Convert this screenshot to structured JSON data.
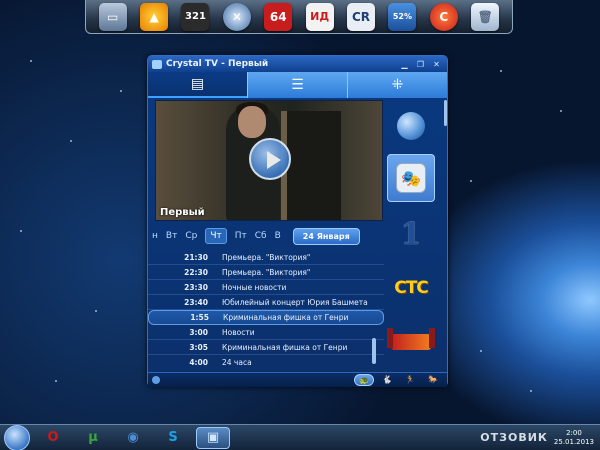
{
  "dock": {
    "icons": [
      {
        "name": "computer-icon",
        "label": ""
      },
      {
        "name": "aimp-icon",
        "label": ""
      },
      {
        "name": "media-player-classic-icon",
        "label": "321"
      },
      {
        "name": "xion-icon",
        "label": ""
      },
      {
        "name": "aida64-icon",
        "label": "64"
      },
      {
        "name": "abbyy-icon",
        "label": "ИД"
      },
      {
        "name": "crystal-reports-icon",
        "label": "CR"
      },
      {
        "name": "a-52-icon",
        "label": "52%"
      },
      {
        "name": "ccleaner-icon",
        "label": ""
      },
      {
        "name": "recycle-bin-icon",
        "label": ""
      }
    ]
  },
  "window": {
    "title": "Crystal TV - Первый",
    "nav_tabs": [
      {
        "name": "tab-player",
        "icon": "▤"
      },
      {
        "name": "tab-list",
        "icon": "☰"
      },
      {
        "name": "tab-channels",
        "icon": "⁜"
      }
    ],
    "video": {
      "channel_caption": "Первый"
    },
    "days": [
      "н",
      "Вт",
      "Ср",
      "Чт",
      "Пт",
      "Сб",
      "В"
    ],
    "active_day_index": 3,
    "date_label": "24 Января",
    "schedule": [
      {
        "time": "21:30",
        "show": "Премьера. \"Виктория\""
      },
      {
        "time": "22:30",
        "show": "Премьера. \"Виктория\""
      },
      {
        "time": "23:30",
        "show": "Ночные новости"
      },
      {
        "time": "23:40",
        "show": "Юбилейный концерт Юрия Башмета"
      },
      {
        "time": "1:55",
        "show": "Криминальная фишка от Генри",
        "current": true
      },
      {
        "time": "3:00",
        "show": "Новости"
      },
      {
        "time": "3:05",
        "show": "Криминальная фишка от Генри"
      },
      {
        "time": "4:00",
        "show": "24 часа"
      }
    ],
    "channels": [
      {
        "name": "channel-globe-icon"
      },
      {
        "name": "channel-masks-icon"
      },
      {
        "name": "channel-perviy-logo",
        "label": "1"
      },
      {
        "name": "channel-sts-logo",
        "label": "СТС"
      },
      {
        "name": "channel-peretz-logo"
      }
    ],
    "bottom_speeds": [
      "🐢",
      "🐇",
      "🏃",
      "🐎"
    ]
  },
  "taskbar": {
    "items": [
      {
        "name": "opera-taskbar-icon",
        "label": "O",
        "color": "#d01818"
      },
      {
        "name": "utorrent-taskbar-icon",
        "label": "µ",
        "color": "#3aa53a"
      },
      {
        "name": "disc-taskbar-icon",
        "label": "◉",
        "color": "#4c8fd6"
      },
      {
        "name": "skype-taskbar-icon",
        "label": "S",
        "color": "#1ea0e6"
      },
      {
        "name": "crystal-tv-taskbar-icon",
        "label": "▣",
        "color": "#7fb3ee",
        "active": true
      }
    ],
    "watermark": "ОТЗОВИК",
    "clock_time": "2:00",
    "clock_date": "25.01.2013"
  }
}
